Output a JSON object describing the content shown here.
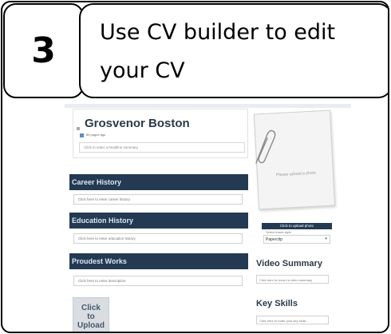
{
  "step": {
    "number": "3",
    "title_line1": "Use CV builder to edit",
    "title_line2": "your CV"
  },
  "cv": {
    "name": "Grosvenor Boston",
    "subline": "85 pages ago",
    "headline_placeholder": "Click to enter a headline summary",
    "sections": [
      {
        "title": "Career History",
        "placeholder": "Click here to enter career history"
      },
      {
        "title": "Education History",
        "placeholder": "Click here to enter education history"
      },
      {
        "title": "Proudest Works",
        "placeholder": "Click here to enter description"
      }
    ],
    "upload_tile": {
      "line1": "Click",
      "line2": "to",
      "line3": "Upload"
    },
    "photo": {
      "caption": "Please upload a photo",
      "upload_button": "Click to upload photo",
      "frame_label": "Select frame style",
      "frame_value": "Paperclip"
    },
    "video": {
      "heading": "Video Summary",
      "placeholder": "Click here to record a video summary"
    },
    "skills": {
      "heading": "Key Skills",
      "placeholder": "Click here to enter your key skills"
    }
  },
  "colors": {
    "section_bar": "#243a53",
    "heading_text": "#2b3a47"
  }
}
